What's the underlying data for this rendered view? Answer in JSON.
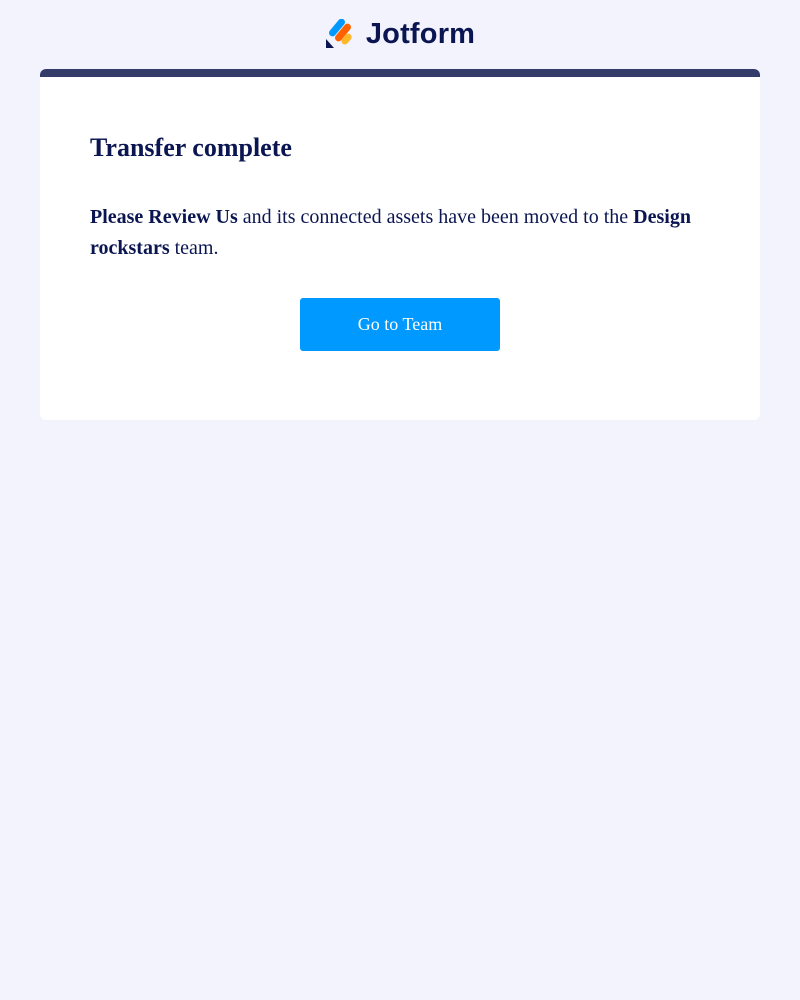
{
  "header": {
    "logo_text": "Jotform",
    "logo_icon": "jotform-logo-icon"
  },
  "card": {
    "title": "Transfer complete",
    "message": {
      "form_name": "Please Review Us",
      "middle_text": " and its connected assets have been moved to the ",
      "team_name": "Design rockstars",
      "end_text": " team."
    },
    "button_label": "Go to Team"
  },
  "colors": {
    "background": "#f2f3fc",
    "card_accent_bar": "#343c6a",
    "text": "#0a1551",
    "button": "#0099ff",
    "logo_blue": "#0099ff",
    "logo_orange": "#ff6100",
    "logo_yellow": "#ffb629",
    "logo_navy": "#0a1551"
  }
}
